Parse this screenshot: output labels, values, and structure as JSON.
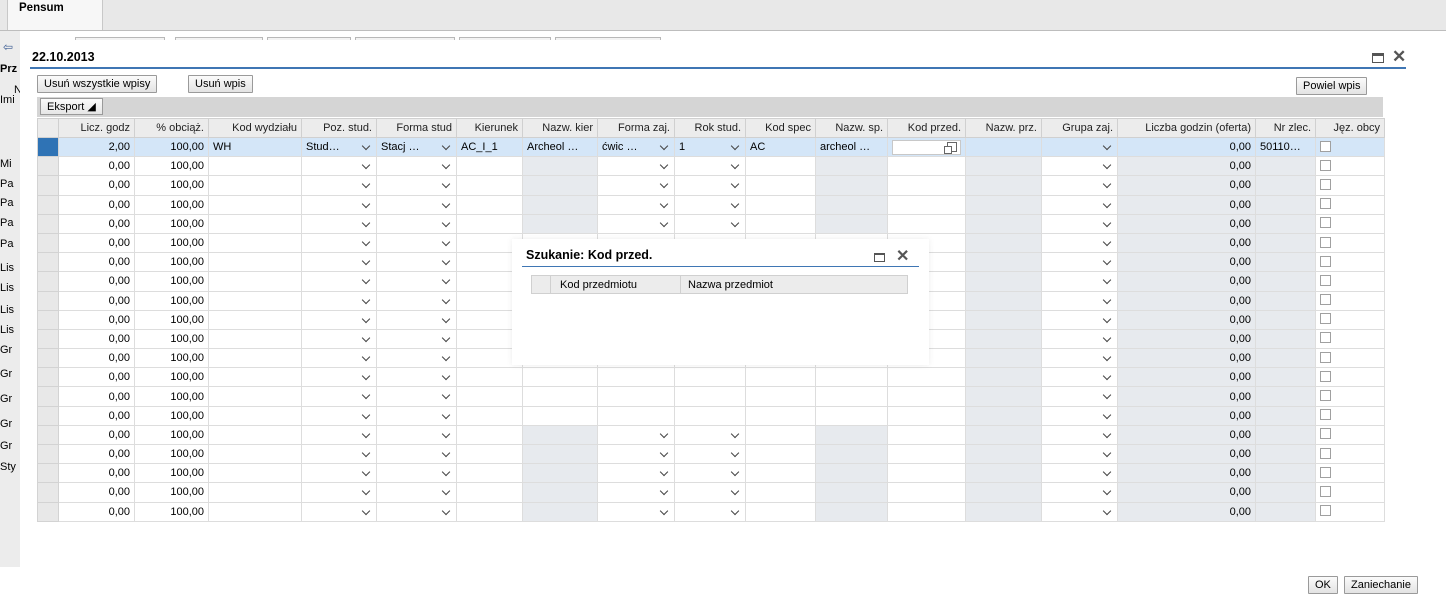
{
  "app": {
    "tab": "Pensum"
  },
  "background": {
    "side_labels": [
      "Prz",
      "N",
      "Imi",
      "Mi",
      "Pa",
      "Pa",
      "Pa",
      "Pa",
      "Lis",
      "Lis",
      "Lis",
      "Lis",
      "Gr",
      "Gr",
      "Gr",
      "Gr",
      "Gr",
      "Sty"
    ]
  },
  "dialog": {
    "title": "22.10.2013",
    "buttons": {
      "delete_all": "Usuń wszystkie wpisy",
      "delete": "Usuń wpis",
      "repeat": "Powiel wpis",
      "ok": "OK",
      "cancel": "Zaniechanie"
    },
    "export": "Eksport"
  },
  "grid": {
    "columns": [
      "Licz. godz",
      "% obciąż.",
      "Kod wydziału",
      "Poz. stud.",
      "Forma stud",
      "Kierunek",
      "Nazw. kier",
      "Forma zaj.",
      "Rok stud.",
      "Kod spec",
      "Nazw. sp.",
      "Kod przed.",
      "Nazw. prz.",
      "Grupa zaj.",
      "Liczba godzin (oferta)",
      "Nr zlec.",
      "Jęz. obcy"
    ],
    "first_row": {
      "licz_godz": "2,00",
      "obciaz": "100,00",
      "kod_wydzialu": "WH",
      "poz_stud": "Stud…",
      "forma_stud": "Stacj …",
      "kierunek": "AC_I_1",
      "nazw_kier": "Archeol …",
      "forma_zaj": "ćwic …",
      "rok_stud": "1",
      "kod_spec": "AC",
      "nazw_sp": "archeol …",
      "oferta": "0,00",
      "nr_zlec": "50110…"
    },
    "empty_row": {
      "licz_godz": "0,00",
      "obciaz": "100,00",
      "oferta": "0,00"
    },
    "empty_row_count": 19
  },
  "search_popup": {
    "title": "Szukanie: Kod przed.",
    "columns": [
      "Kod przedmiotu",
      "Nazwa przedmiot"
    ]
  },
  "colors": {
    "accent": "#3f76b4",
    "selected_row": "#d4e6f8",
    "row_marker": "#2f73b5"
  }
}
